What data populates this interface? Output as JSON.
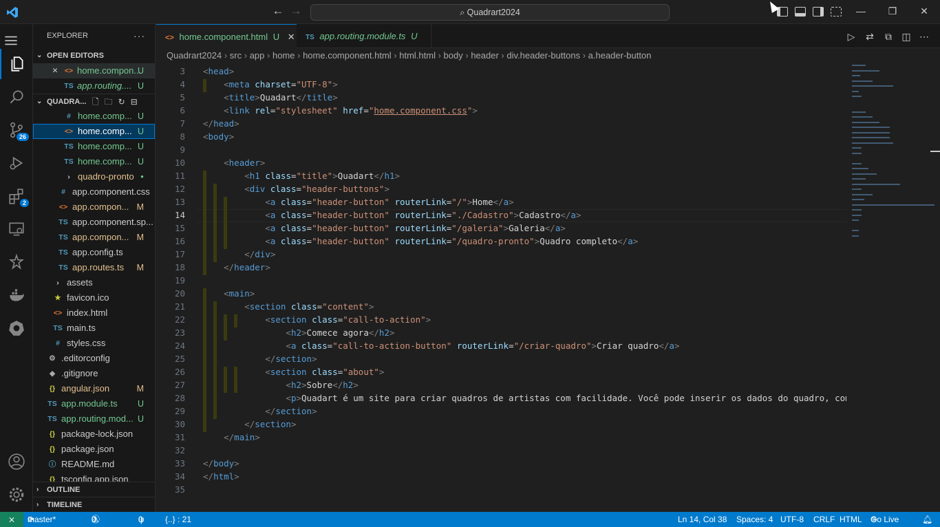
{
  "titlebar": {
    "search": "Quadrart2024",
    "back_icon": "arrow-left-icon",
    "forward_icon": "arrow-right-icon"
  },
  "activity_bar": {
    "scm_badge": "26",
    "extensions_badge": "2"
  },
  "explorer": {
    "title": "EXPLORER",
    "more": "···",
    "open_editors_label": "OPEN EDITORS",
    "open_editors": [
      {
        "name": "home.compon...",
        "status": "U",
        "icon": "<>"
      },
      {
        "name": "app.routing....",
        "status": "U",
        "icon": "TS"
      }
    ],
    "project_label": "QUADRA...",
    "tree": [
      {
        "name": "home.comp...",
        "status": "U",
        "icon": "#",
        "kind": "css",
        "indent": 2
      },
      {
        "name": "home.comp...",
        "status": "U",
        "icon": "<>",
        "kind": "html",
        "indent": 2,
        "selected": true
      },
      {
        "name": "home.comp...",
        "status": "U",
        "icon": "TS",
        "kind": "ts",
        "indent": 2
      },
      {
        "name": "home.comp...",
        "status": "U",
        "icon": "TS",
        "kind": "ts",
        "indent": 2
      },
      {
        "name": "quadro-pronto",
        "status": "●",
        "icon": "›",
        "kind": "folder",
        "indent": 2
      },
      {
        "name": "app.component.css",
        "status": "",
        "icon": "#",
        "kind": "css",
        "indent": 1
      },
      {
        "name": "app.compon...",
        "status": "M",
        "icon": "<>",
        "kind": "html",
        "indent": 1
      },
      {
        "name": "app.component.sp...",
        "status": "",
        "icon": "TS",
        "kind": "ts",
        "indent": 1
      },
      {
        "name": "app.compon...",
        "status": "M",
        "icon": "TS",
        "kind": "ts",
        "indent": 1
      },
      {
        "name": "app.config.ts",
        "status": "",
        "icon": "TS",
        "kind": "ts",
        "indent": 1
      },
      {
        "name": "app.routes.ts",
        "status": "M",
        "icon": "TS",
        "kind": "ts",
        "indent": 1
      },
      {
        "name": "assets",
        "status": "",
        "icon": "›",
        "kind": "folder",
        "indent": 0
      },
      {
        "name": "favicon.ico",
        "status": "",
        "icon": "★",
        "kind": "ico",
        "indent": 0
      },
      {
        "name": "index.html",
        "status": "",
        "icon": "<>",
        "kind": "html",
        "indent": 0
      },
      {
        "name": "main.ts",
        "status": "",
        "icon": "TS",
        "kind": "ts",
        "indent": 0
      },
      {
        "name": "styles.css",
        "status": "",
        "icon": "#",
        "kind": "css",
        "indent": 0
      },
      {
        "name": ".editorconfig",
        "status": "",
        "icon": "⚙",
        "kind": "cfg",
        "indent": -1
      },
      {
        "name": ".gitignore",
        "status": "",
        "icon": "◆",
        "kind": "git",
        "indent": -1
      },
      {
        "name": "angular.json",
        "status": "M",
        "icon": "{}",
        "kind": "json",
        "indent": -1
      },
      {
        "name": "app.module.ts",
        "status": "U",
        "icon": "TS",
        "kind": "ts",
        "indent": -1
      },
      {
        "name": "app.routing.mod...",
        "status": "U",
        "icon": "TS",
        "kind": "ts",
        "indent": -1
      },
      {
        "name": "package-lock.json",
        "status": "",
        "icon": "{}",
        "kind": "json",
        "indent": -1
      },
      {
        "name": "package.json",
        "status": "",
        "icon": "{}",
        "kind": "json",
        "indent": -1
      },
      {
        "name": "README.md",
        "status": "",
        "icon": "ⓘ",
        "kind": "md",
        "indent": -1
      },
      {
        "name": "tsconfig.app.json",
        "status": "",
        "icon": "{}",
        "kind": "json",
        "indent": -1
      }
    ],
    "outline_label": "OUTLINE",
    "timeline_label": "TIMELINE"
  },
  "tabs": [
    {
      "label": "home.component.html",
      "status": "U",
      "icon": "<>"
    },
    {
      "label": "app.routing.module.ts",
      "status": "U",
      "icon": "TS"
    }
  ],
  "breadcrumb": [
    "Quadrart2024",
    "src",
    "app",
    "home",
    "home.component.html",
    "html.html",
    "body",
    "header",
    "div.header-buttons",
    "a.header-button"
  ],
  "code": {
    "current_line": 14,
    "lines": [
      {
        "n": "3",
        "html": "<span class='t'>&lt;</span><span class='tg'>head</span><span class='t'>&gt;</span>"
      },
      {
        "n": "4",
        "html": "  <span class='t'>&lt;</span><span class='tg'>meta</span> <span class='at'>charset</span>=<span class='sv'>\"UTF-8\"</span><span class='t'>&gt;</span>"
      },
      {
        "n": "5",
        "html": "  <span class='t'>&lt;</span><span class='tg'>title</span><span class='t'>&gt;</span>Quadart<span class='t'>&lt;/</span><span class='tg'>title</span><span class='t'>&gt;</span>"
      },
      {
        "n": "6",
        "html": "  <span class='t'>&lt;</span><span class='tg'>link</span> <span class='at'>rel</span>=<span class='sv'>\"stylesheet\"</span> <span class='at'>href</span>=<span class='sv'>\"<u>home.component.css</u>\"</span><span class='t'>&gt;</span>"
      },
      {
        "n": "7",
        "html": "<span class='t'>&lt;/</span><span class='tg'>head</span><span class='t'>&gt;</span>"
      },
      {
        "n": "8",
        "html": "<span class='t'>&lt;</span><span class='tg'>body</span><span class='t'>&gt;</span>"
      },
      {
        "n": "9",
        "html": ""
      },
      {
        "n": "10",
        "html": "  <span class='t'>&lt;</span><span class='tg'>header</span><span class='t'>&gt;</span>"
      },
      {
        "n": "11",
        "html": "    <span class='t'>&lt;</span><span class='tg'>h1</span> <span class='at'>class</span>=<span class='sv'>\"title\"</span><span class='t'>&gt;</span>Quadart<span class='t'>&lt;/</span><span class='tg'>h1</span><span class='t'>&gt;</span>"
      },
      {
        "n": "12",
        "html": "    <span class='t'>&lt;</span><span class='tg'>div</span> <span class='at'>class</span>=<span class='sv'>\"header-buttons\"</span><span class='t'>&gt;</span>"
      },
      {
        "n": "13",
        "html": "      <span class='t'>&lt;</span><span class='tg'>a</span> <span class='at'>class</span>=<span class='sv'>\"header-button\"</span> <span class='at'>routerLink</span>=<span class='sv'>\"/\"</span><span class='t'>&gt;</span>Home<span class='t'>&lt;/</span><span class='tg'>a</span><span class='t'>&gt;</span>"
      },
      {
        "n": "14",
        "html": "      <span class='t'>&lt;</span><span class='tg'>a</span> <span class='at'>class</span>=<span class='sv'>\"header-button\"</span> <span class='at'>routerLink</span>=<span class='sv'>\"./Cadastro\"</span><span class='t'>&gt;</span>Cadastro<span class='t'>&lt;/</span><span class='tg'>a</span><span class='t'>&gt;</span>"
      },
      {
        "n": "15",
        "html": "      <span class='t'>&lt;</span><span class='tg'>a</span> <span class='at'>class</span>=<span class='sv'>\"header-button\"</span> <span class='at'>routerLink</span>=<span class='sv'>\"/galeria\"</span><span class='t'>&gt;</span>Galeria<span class='t'>&lt;/</span><span class='tg'>a</span><span class='t'>&gt;</span>"
      },
      {
        "n": "16",
        "html": "      <span class='t'>&lt;</span><span class='tg'>a</span> <span class='at'>class</span>=<span class='sv'>\"header-button\"</span> <span class='at'>routerLink</span>=<span class='sv'>\"/quadro-pronto\"</span><span class='t'>&gt;</span>Quadro completo<span class='t'>&lt;/</span><span class='tg'>a</span><span class='t'>&gt;</span>"
      },
      {
        "n": "17",
        "html": "    <span class='t'>&lt;/</span><span class='tg'>div</span><span class='t'>&gt;</span>"
      },
      {
        "n": "18",
        "html": "  <span class='t'>&lt;/</span><span class='tg'>header</span><span class='t'>&gt;</span>"
      },
      {
        "n": "19",
        "html": ""
      },
      {
        "n": "20",
        "html": "  <span class='t'>&lt;</span><span class='tg'>main</span><span class='t'>&gt;</span>"
      },
      {
        "n": "21",
        "html": "    <span class='t'>&lt;</span><span class='tg'>section</span> <span class='at'>class</span>=<span class='sv'>\"content\"</span><span class='t'>&gt;</span>"
      },
      {
        "n": "22",
        "html": "      <span class='t'>&lt;</span><span class='tg'>section</span> <span class='at'>class</span>=<span class='sv'>\"call-to-action\"</span><span class='t'>&gt;</span>"
      },
      {
        "n": "23",
        "html": "        <span class='t'>&lt;</span><span class='tg'>h2</span><span class='t'>&gt;</span>Comece agora<span class='t'>&lt;/</span><span class='tg'>h2</span><span class='t'>&gt;</span>"
      },
      {
        "n": "24",
        "html": "        <span class='t'>&lt;</span><span class='tg'>a</span> <span class='at'>class</span>=<span class='sv'>\"call-to-action-button\"</span> <span class='at'>routerLink</span>=<span class='sv'>\"/criar-quadro\"</span><span class='t'>&gt;</span>Criar quadro<span class='t'>&lt;/</span><span class='tg'>a</span><span class='t'>&gt;</span>"
      },
      {
        "n": "25",
        "html": "      <span class='t'>&lt;/</span><span class='tg'>section</span><span class='t'>&gt;</span>"
      },
      {
        "n": "26",
        "html": "      <span class='t'>&lt;</span><span class='tg'>section</span> <span class='at'>class</span>=<span class='sv'>\"about\"</span><span class='t'>&gt;</span>"
      },
      {
        "n": "27",
        "html": "        <span class='t'>&lt;</span><span class='tg'>h2</span><span class='t'>&gt;</span>Sobre<span class='t'>&lt;/</span><span class='tg'>h2</span><span class='t'>&gt;</span>"
      },
      {
        "n": "28",
        "html": "        <span class='t'>&lt;</span><span class='tg'>p</span><span class='t'>&gt;</span>Quadart é um site para criar quadros de artistas com facilidade. Você pode inserir os dados do quadro, como nom"
      },
      {
        "n": "29",
        "html": "      <span class='t'>&lt;/</span><span class='tg'>section</span><span class='t'>&gt;</span>"
      },
      {
        "n": "30",
        "html": "    <span class='t'>&lt;/</span><span class='tg'>section</span><span class='t'>&gt;</span>"
      },
      {
        "n": "31",
        "html": "  <span class='t'>&lt;/</span><span class='tg'>main</span><span class='t'>&gt;</span>"
      },
      {
        "n": "32",
        "html": ""
      },
      {
        "n": "33",
        "html": "<span class='t'>&lt;/</span><span class='tg'>body</span><span class='t'>&gt;</span>"
      },
      {
        "n": "34",
        "html": "<span class='t'>&lt;/</span><span class='tg'>html</span><span class='t'>&gt;</span>"
      },
      {
        "n": "35",
        "html": ""
      }
    ]
  },
  "status": {
    "branch": "master*",
    "errors": "0",
    "warnings": "0",
    "ports": "0",
    "braces": "{..} : 21",
    "position": "Ln 14, Col 38",
    "spaces": "Spaces: 4",
    "encoding": "UTF-8",
    "eol": "CRLF",
    "language": "HTML",
    "golive": "Go Live"
  },
  "colors": {
    "accent": "#0078d4",
    "statusbar": "#007acc",
    "untracked": "#73c991",
    "modified": "#e2c08d"
  }
}
